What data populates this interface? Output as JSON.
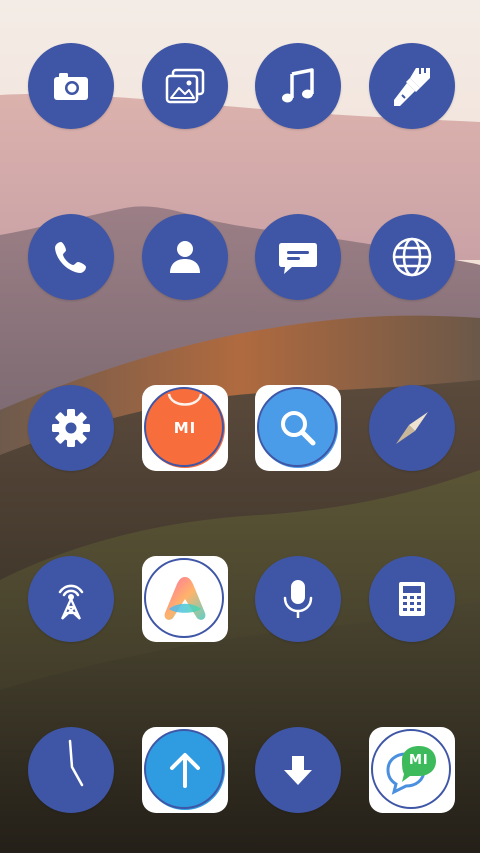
{
  "screen": {
    "type": "home-screen-icon-grid",
    "icon_color": "#3f56a6",
    "wallpaper": "mountain-sunset"
  },
  "apps": [
    {
      "icon": "camera-icon"
    },
    {
      "icon": "gallery-icon"
    },
    {
      "icon": "music-icon"
    },
    {
      "icon": "themes-brush-icon"
    },
    {
      "icon": "phone-icon"
    },
    {
      "icon": "contacts-icon"
    },
    {
      "icon": "messages-icon"
    },
    {
      "icon": "browser-globe-icon"
    },
    {
      "icon": "settings-gear-icon"
    },
    {
      "icon": "mi-store-icon",
      "label": "MI",
      "color": "#f76d3c"
    },
    {
      "icon": "search-icon",
      "color": "#4a9be8"
    },
    {
      "icon": "compass-icon"
    },
    {
      "icon": "fm-radio-tower-icon"
    },
    {
      "icon": "app-vault-icon"
    },
    {
      "icon": "recorder-microphone-icon"
    },
    {
      "icon": "calculator-icon"
    },
    {
      "icon": "clock-icon"
    },
    {
      "icon": "updater-arrow-up-icon",
      "color": "#2f9be0"
    },
    {
      "icon": "downloads-arrow-icon"
    },
    {
      "icon": "mi-community-icon",
      "label": "MI",
      "color": "#3dbb5c"
    }
  ]
}
